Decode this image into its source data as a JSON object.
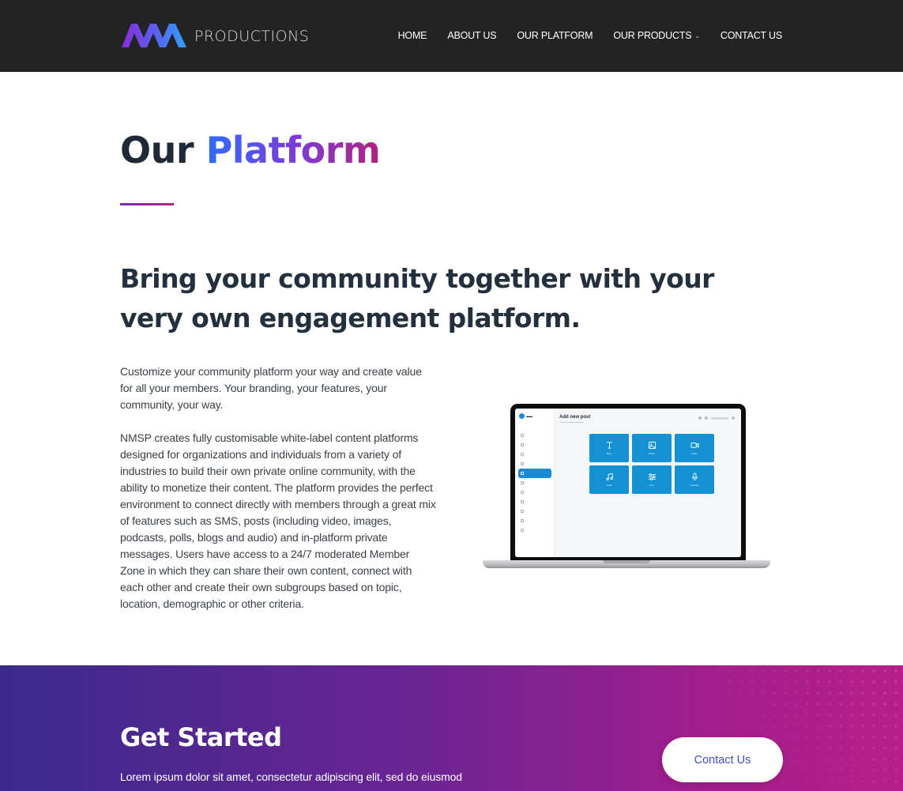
{
  "header": {
    "logo_text": "PRODUCTIONS",
    "nav": [
      {
        "label": "HOME"
      },
      {
        "label": "ABOUT US"
      },
      {
        "label": "OUR PLATFORM"
      },
      {
        "label": "OUR PRODUCTS",
        "has_dropdown": true
      },
      {
        "label": "CONTACT US"
      }
    ]
  },
  "main": {
    "title_part1": "Our",
    "title_part2": "Platform",
    "headline": "Bring your community together with your very own engagement platform.",
    "paragraphs": [
      "Customize your community platform your way and create value for all your members. Your branding, your features, your community, your way.",
      "NMSP creates fully customisable white-label content platforms designed for organizations and individuals from a variety of industries to build their own private online community, with the ability to monetize their content. The platform provides the perfect environment to connect directly with members through a great mix of features such as SMS, posts (including video, images, podcasts, polls, blogs and audio) and in-platform private messages. Users have access to a 24/7 moderated Member Zone in which they can share their own content, connect with each other and create their own subgroups based on topic, location, demographic or other criteria."
    ]
  },
  "laptop_screen": {
    "header": "Add new post",
    "tiles": [
      {
        "label": "Blog",
        "icon": "text-icon"
      },
      {
        "label": "Photo",
        "icon": "image-icon"
      },
      {
        "label": "Video",
        "icon": "video-icon"
      },
      {
        "label": "Audio",
        "icon": "music-icon"
      },
      {
        "label": "Poll",
        "icon": "sliders-icon"
      },
      {
        "label": "Podcast",
        "icon": "microphone-icon"
      }
    ]
  },
  "cta": {
    "title": "Get Started",
    "text": "Lorem ipsum dolor sit amet, consectetur adipiscing elit, sed do eiusmod",
    "button_label": "Contact Us"
  },
  "colors": {
    "header_bg": "#232323",
    "accent_blue": "#2f6bff",
    "accent_magenta": "#b1237e",
    "tile_blue": "#1391d2",
    "cta_start": "#3a2a8c",
    "cta_end": "#b61f8a"
  }
}
